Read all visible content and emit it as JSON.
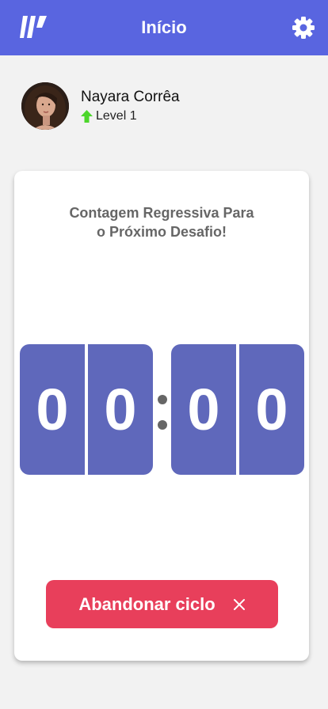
{
  "header": {
    "title": "Início",
    "logo_icon": "moveit-logo-icon",
    "settings_icon": "gear-icon",
    "color": "#5965e0"
  },
  "profile": {
    "name": "Nayara Corrêa",
    "level_text": "Level 1",
    "level_icon": "arrow-up-icon"
  },
  "countdown": {
    "title_line1": "Contagem Regressiva Para",
    "title_line2": "o Próximo Desafio!",
    "minute_left": "0",
    "minute_right": "0",
    "second_left": "0",
    "second_right": "0"
  },
  "actions": {
    "abandon_label": "Abandonar ciclo",
    "abandon_icon": "close-icon",
    "abandon_color": "#e83f5b"
  }
}
